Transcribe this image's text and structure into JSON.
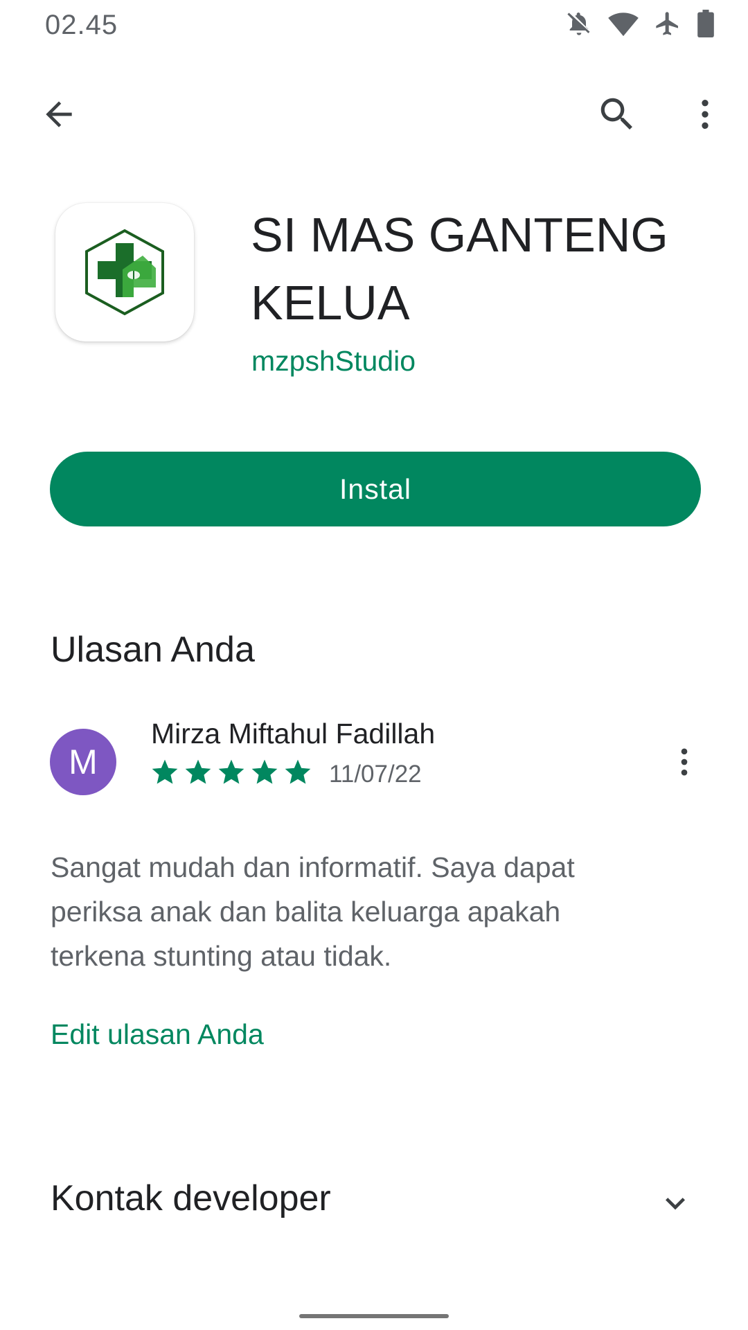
{
  "status_bar": {
    "time": "02.45",
    "icons": [
      "notifications-off-icon",
      "wifi-icon",
      "airplane-icon",
      "battery-icon"
    ]
  },
  "app_bar": {
    "icons": [
      "back-arrow-icon",
      "search-icon",
      "more-vert-icon"
    ]
  },
  "app": {
    "title": "SI MAS GANTENG KELUA",
    "developer": "mzpshStudio",
    "icon": "health-cross-house-icon",
    "install_label": "Instal"
  },
  "review": {
    "section_title": "Ulasan Anda",
    "avatar_letter": "M",
    "reviewer_name": "Mirza Miftahul Fadillah",
    "rating": 5,
    "rating_max": 5,
    "date": "11/07/22",
    "text": "Sangat mudah dan informatif. Saya dapat periksa anak dan balita keluarga apakah terkena stunting atau tidak.",
    "edit_label": "Edit ulasan Anda"
  },
  "contact": {
    "title": "Kontak developer"
  },
  "colors": {
    "accent": "#01875f",
    "avatar": "#7e57c2",
    "text_primary": "#202124",
    "text_secondary": "#5f6368"
  }
}
